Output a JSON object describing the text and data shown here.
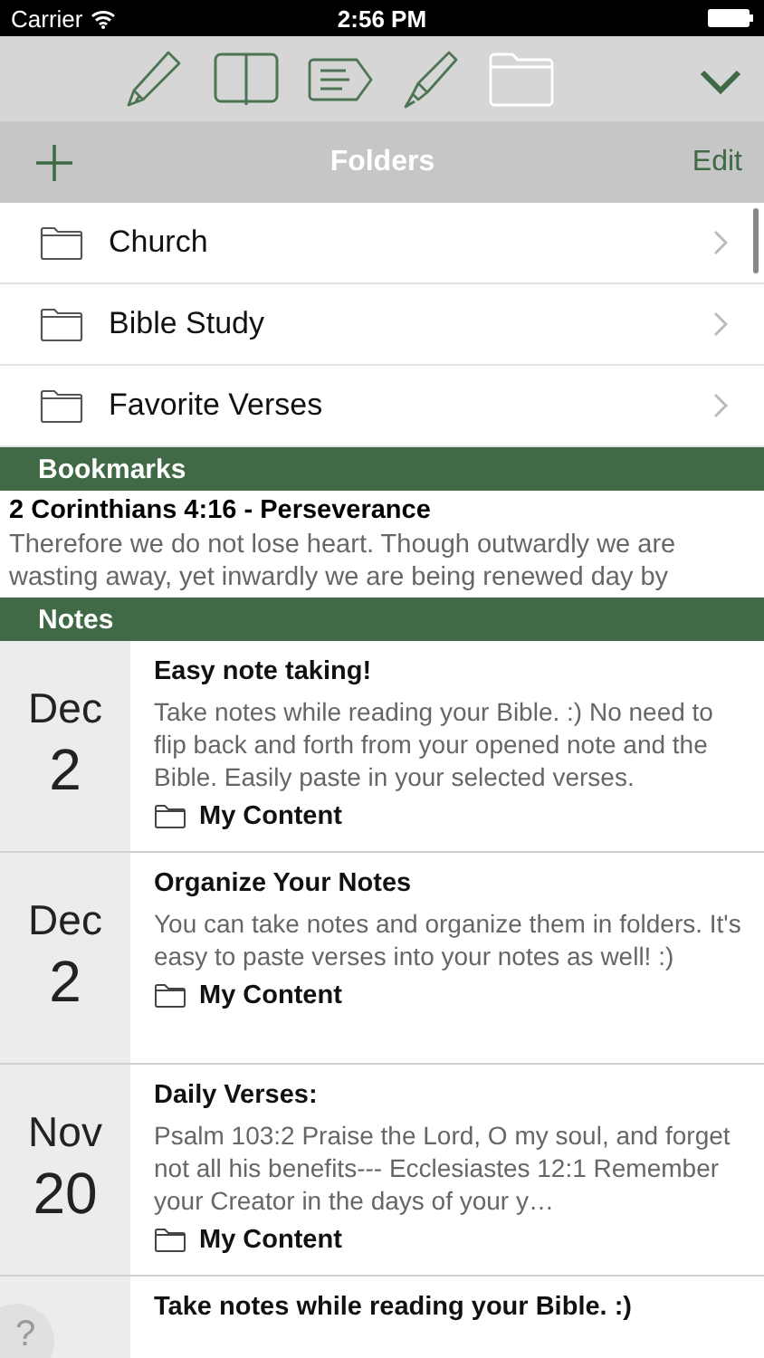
{
  "status_bar": {
    "carrier": "Carrier",
    "time": "2:56 PM"
  },
  "toolbar": {
    "tools": [
      {
        "kind": "pencil",
        "selected": false
      },
      {
        "kind": "book",
        "selected": false
      },
      {
        "kind": "tag",
        "selected": false
      },
      {
        "kind": "highlighter",
        "selected": false
      },
      {
        "kind": "folder",
        "selected": true
      }
    ]
  },
  "folders": {
    "title": "Folders",
    "edit": "Edit",
    "items": [
      {
        "label": "Church"
      },
      {
        "label": "Bible Study"
      },
      {
        "label": "Favorite Verses"
      }
    ]
  },
  "bookmarks": {
    "title": "Bookmarks",
    "items": [
      {
        "title": "2 Corinthians 4:16 - Perseverance",
        "text": "Therefore we do not lose heart. Though outwardly we are wasting away, yet inwardly we are being renewed day by"
      }
    ]
  },
  "notes": {
    "title": "Notes",
    "items": [
      {
        "month": "Dec",
        "day": "2",
        "title": "Easy note taking!",
        "body": "Take notes while reading your Bible. :)   No need to flip back and forth from your opened note and the Bible. Easily paste in your selected verses.",
        "folder": "My Content"
      },
      {
        "month": "Dec",
        "day": "2",
        "title": "Organize Your Notes",
        "body": "You can take notes and organize them in folders. It's easy to paste verses into your notes as well! :)",
        "folder": "My Content"
      },
      {
        "month": "Nov",
        "day": "20",
        "title": "Daily Verses:",
        "body": "Psalm 103:2 Praise the Lord, O my soul, and forget not all his benefits---  Ecclesiastes 12:1 Remember your Creator in the days of your y…",
        "folder": "My Content"
      },
      {
        "title": "Take notes while reading your Bible. :)"
      }
    ]
  },
  "help_button": "?"
}
